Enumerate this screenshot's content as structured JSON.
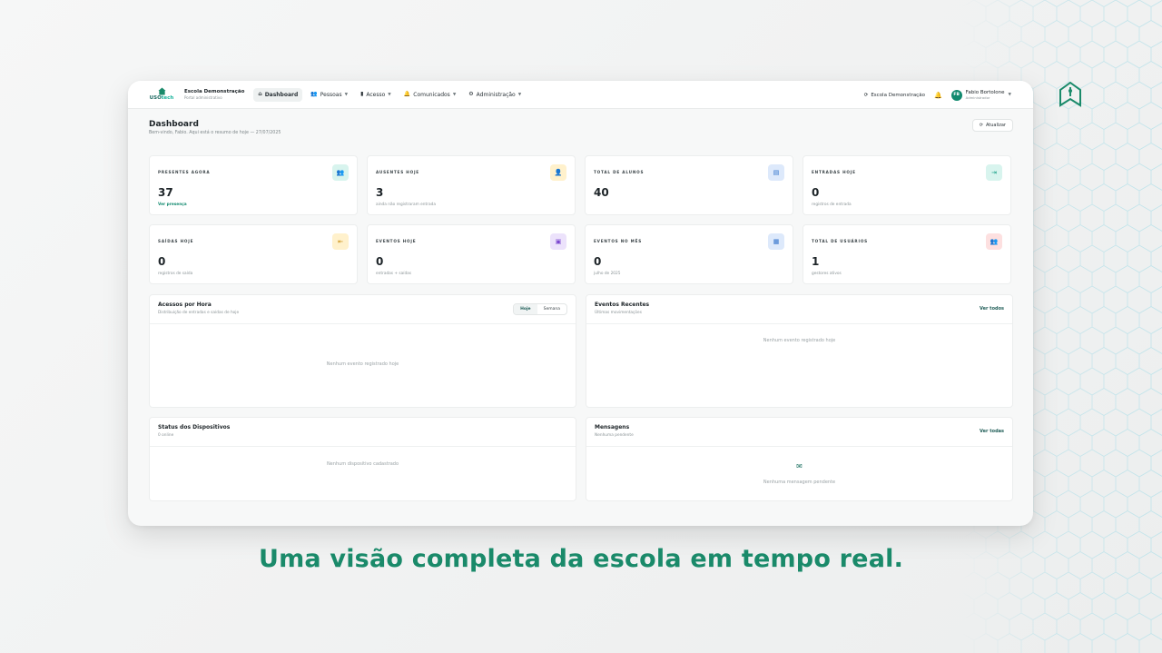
{
  "brand": {
    "logo_text_a": "USO",
    "logo_text_b": "tech",
    "school_name": "Escola Demonstração",
    "school_sub": "Portal administrativo"
  },
  "nav": {
    "items": [
      {
        "label": "Dashboard",
        "icon": "home-icon",
        "active": true
      },
      {
        "label": "Pessoas",
        "icon": "people-icon"
      },
      {
        "label": "Acesso",
        "icon": "door-icon"
      },
      {
        "label": "Comunicados",
        "icon": "bell-icon"
      },
      {
        "label": "Administração",
        "icon": "gear-icon"
      }
    ]
  },
  "topbar": {
    "school_switch": "Escola Demonstração",
    "user_initials": "FB",
    "user_name": "Fabio Bortolone",
    "user_role": "Administrador"
  },
  "page": {
    "title": "Dashboard",
    "subtitle": "Bem-vindo, Fabio. Aqui está o resumo de hoje — 27/07/2025",
    "refresh_label": "Atualizar"
  },
  "stats": [
    {
      "label": "PRESENTES AGORA",
      "value": "37",
      "note": "Ver presença",
      "link": true,
      "icon_bg": "#d8f4ee",
      "icon_fg": "#179f86"
    },
    {
      "label": "AUSENTES HOJE",
      "value": "3",
      "note": "ainda não registraram entrada",
      "icon_bg": "#fff1cc",
      "icon_fg": "#c98b0b"
    },
    {
      "label": "TOTAL DE ALUNOS",
      "value": "40",
      "note": "",
      "icon_bg": "#dde9fb",
      "icon_fg": "#2c6ecb"
    },
    {
      "label": "ENTRADAS HOJE",
      "value": "0",
      "note": "registros de entrada",
      "icon_bg": "#d8f4ee",
      "icon_fg": "#179f86"
    },
    {
      "label": "SAÍDAS HOJE",
      "value": "0",
      "note": "registros de saída",
      "icon_bg": "#fff1cc",
      "icon_fg": "#c98b0b"
    },
    {
      "label": "EVENTOS HOJE",
      "value": "0",
      "note": "entradas + saídas",
      "icon_bg": "#ece2fb",
      "icon_fg": "#7a45cf"
    },
    {
      "label": "EVENTOS NO MÊS",
      "value": "0",
      "note": "julho de 2025",
      "icon_bg": "#dde9fb",
      "icon_fg": "#2c6ecb"
    },
    {
      "label": "TOTAL DE USUÁRIOS",
      "value": "1",
      "note": "gestores ativos",
      "icon_bg": "#fde0e0",
      "icon_fg": "#d14747"
    }
  ],
  "panels": {
    "access": {
      "title": "Acessos por Hora",
      "sub": "Distribuição de entradas e saídas de hoje",
      "toggle_a": "Hoje",
      "toggle_b": "Semana",
      "empty": "Nenhum evento registrado hoje"
    },
    "events": {
      "title": "Eventos Recentes",
      "sub": "Últimas movimentações",
      "link": "Ver todos",
      "empty": "Nenhum evento registrado hoje"
    },
    "devices": {
      "title": "Status dos Dispositivos",
      "sub": "0 online",
      "empty": "Nenhum dispositivo cadastrado"
    },
    "messages": {
      "title": "Mensagens",
      "sub": "Nenhuma pendente",
      "link": "Ver todas",
      "empty": "Nenhuma mensagem pendente"
    }
  },
  "tagline": "Uma visão completa da escola em tempo real."
}
